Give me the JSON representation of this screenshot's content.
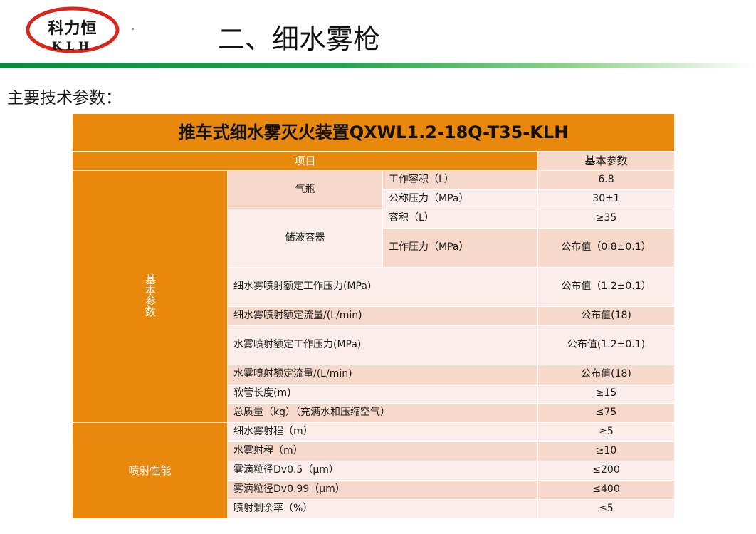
{
  "logo": {
    "top": "科力恒",
    "bottom": "KLH"
  },
  "page_title": "二、细水雾枪",
  "subtitle": "主要技术参数：",
  "table": {
    "title": "推车式细水雾灭火装置QXWL1.2-18Q-T35-KLH",
    "header_item": "项目",
    "header_param": "基本参数",
    "cat_basic": "基本参数",
    "cat_spray": "喷射性能",
    "gas_cylinder": "气瓶",
    "liquid_container": "储液容器",
    "rows": [
      {
        "label": "工作容积（L）",
        "value": "6.8"
      },
      {
        "label": "公称压力（MPa）",
        "value": "30±1"
      },
      {
        "label": "容积（L）",
        "value": "≥35"
      },
      {
        "label": "工作压力（MPa）",
        "value": "公布值（0.8±0.1）"
      },
      {
        "label": "细水雾喷射额定工作压力(MPa)",
        "value": "公布值（1.2±0.1）"
      },
      {
        "label": "细水雾喷射额定流量/(L/min)",
        "value": "公布值(18)"
      },
      {
        "label": "水雾喷射额定工作压力(MPa)",
        "value": "公布值(1.2±0.1)"
      },
      {
        "label": "水雾喷射额定流量/(L/min)",
        "value": "公布值(18)"
      },
      {
        "label": "软管长度(m)",
        "value": "≥15"
      },
      {
        "label": "总质量（kg）（充满水和压缩空气）",
        "value": "≤75"
      },
      {
        "label": "细水雾射程（m）",
        "value": "≥5"
      },
      {
        "label": "水雾射程（m）",
        "value": "≥10"
      },
      {
        "label": "雾滴粒径Dv0.5（μm）",
        "value": "≤200"
      },
      {
        "label": "雾滴粒径Dv0.99（μm）",
        "value": "≤400"
      },
      {
        "label": "喷射剩余率（%）",
        "value": "≤5"
      }
    ]
  },
  "colors": {
    "orange": "#e8890e",
    "row_dark": "#f6d9ca",
    "row_light": "#fbeeea",
    "green_bar": "#0a8a3e",
    "logo_red": "#d9261c"
  }
}
